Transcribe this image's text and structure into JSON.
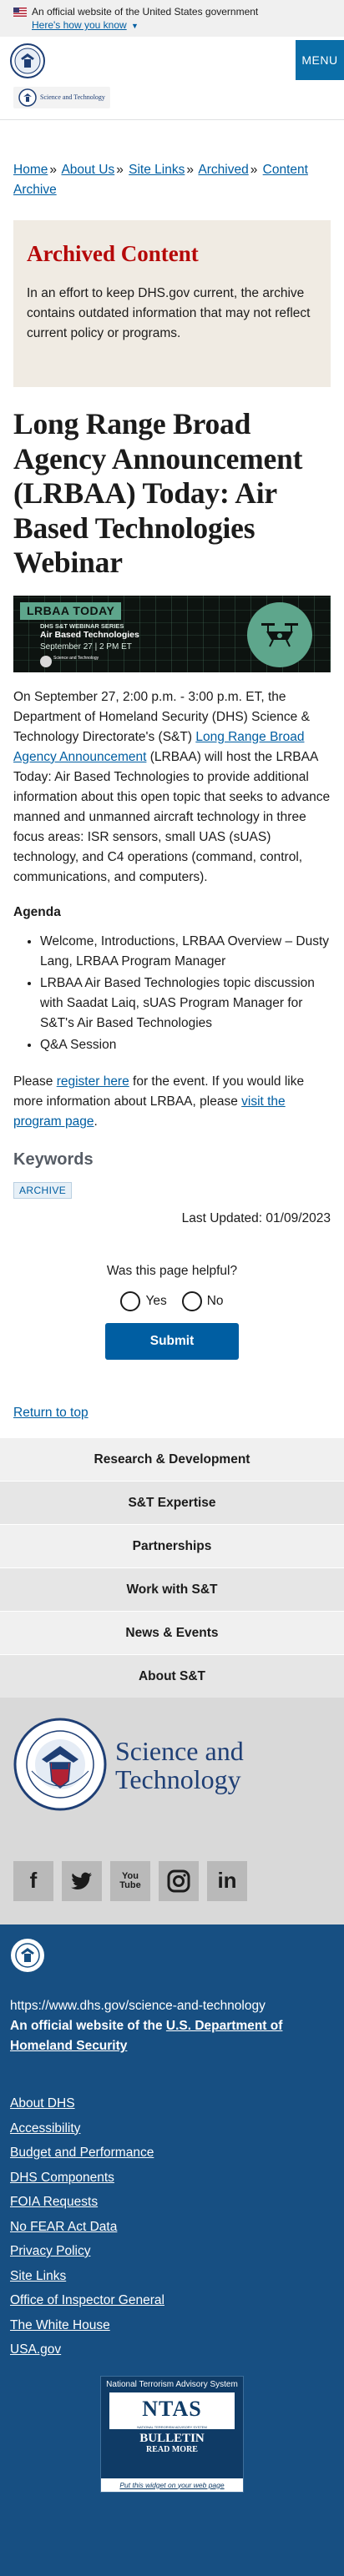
{
  "gov_banner": {
    "official_text": "An official website of the United States government",
    "how_you_know": "Here's how you know"
  },
  "header": {
    "menu_label": "MENU",
    "brand_small": "Science and Technology"
  },
  "breadcrumb": {
    "items": [
      "Home",
      "About Us",
      "Site Links",
      "Archived",
      "Content Archive"
    ],
    "separator": "»"
  },
  "archived": {
    "heading": "Archived Content",
    "text": "In an effort to keep DHS.gov current, the archive contains outdated information that may not reflect current policy or programs."
  },
  "page_title": "Long Range Broad Agency Announcement (LRBAA) Today: Air Based Technologies Webinar",
  "hero": {
    "tag": "LRBAA TODAY",
    "series": "DHS S&T WEBINAR SERIES",
    "topic": "Air Based Technologies",
    "date": "September 27  |  2 PM ET",
    "logo_text": "Science and Technology"
  },
  "body": {
    "p1_before": "On September 27, 2:00 p.m. - 3:00 p.m. ET, the Department of Homeland Security (DHS) Science & Technology Directorate's (S&T) ",
    "p1_link": "Long Range Broad Agency Announcement",
    "p1_after": " (LRBAA) will host the LRBAA Today: Air Based Technologies to provide additional information about this open topic that seeks to advance manned and unmanned aircraft technology in three focus areas: ISR sensors, small UAS (sUAS) technology, and C4 operations (command, control, communications, and computers).",
    "agenda_heading": "Agenda",
    "agenda": [
      "Welcome, Introductions, LRBAA Overview – Dusty Lang, LRBAA Program Manager",
      "LRBAA Air Based Technologies topic discussion with Saadat Laiq, sUAS Program Manager for S&T's Air Based Technologies",
      "Q&A Session"
    ],
    "p2_before": "Please ",
    "p2_link1": "register here",
    "p2_mid": " for the event. If you would like more information about LRBAA, please ",
    "p2_link2": "visit the program page",
    "p2_after": "."
  },
  "keywords": {
    "heading": "Keywords",
    "tags": [
      "ARCHIVE"
    ]
  },
  "last_updated": "Last Updated: 01/09/2023",
  "feedback": {
    "question": "Was this page helpful?",
    "yes": "Yes",
    "no": "No",
    "submit": "Submit"
  },
  "return_to_top": "Return to top",
  "footer_nav": [
    "Research & Development",
    "S&T Expertise",
    "Partnerships",
    "Work with S&T",
    "News & Events",
    "About S&T"
  ],
  "footer_brand": {
    "line1": "Science and",
    "line2": "Technology",
    "seal_text": "DEPARTMENT OF HOMELAND SECURITY"
  },
  "social": {
    "facebook": "f",
    "twitter": "t",
    "youtube": "You Tube",
    "instagram": "instagram-icon",
    "linkedin": "in"
  },
  "footer": {
    "site_url": "https://www.dhs.gov/science-and-technology",
    "official_before": "An official website of the ",
    "official_link": "U.S. Department of Homeland Security",
    "links": [
      "About DHS",
      "Accessibility",
      "Budget and Performance",
      "DHS Components",
      "FOIA Requests",
      "No FEAR Act Data",
      "Privacy Policy",
      "Site Links",
      "Office of Inspector General",
      "The White House",
      "USA.gov"
    ]
  },
  "ntas": {
    "title": "National Terrorism Advisory System",
    "logo": "NTAS",
    "logo_small": "NATIONAL TERRORISM ADVISORY SYSTEM",
    "bulletin": "BULLETIN",
    "read_more": "READ MORE",
    "widget": "Put this widget on your web page"
  },
  "colors": {
    "primary_link": "#005ea2",
    "archived_red": "#b50909",
    "footer_blue": "#174f82",
    "menu_blue": "#0a6ea8"
  }
}
